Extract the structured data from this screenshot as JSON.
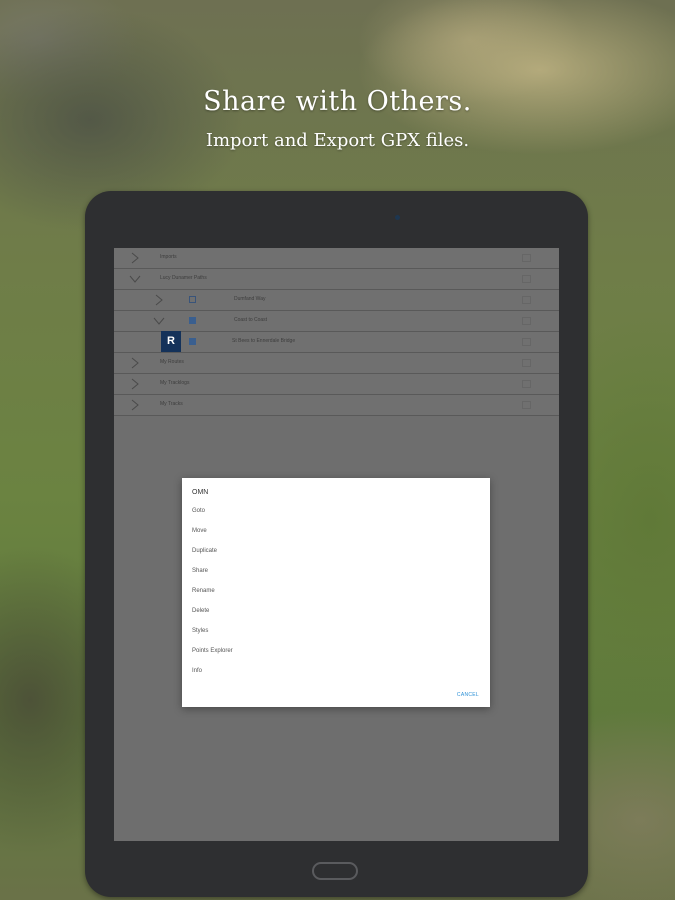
{
  "promo": {
    "headline": "Share with Others.",
    "subline": "Import and Export GPX files."
  },
  "tree": {
    "rows": [
      {
        "label": "Imports",
        "expanded": false,
        "indent": 0
      },
      {
        "label": "Lucy Dunamer Paths",
        "expanded": true,
        "indent": 0
      },
      {
        "label": "Dumfand Way",
        "expanded": false,
        "indent": 1,
        "checked": false
      },
      {
        "label": "Coast to Coast",
        "expanded": true,
        "indent": 1,
        "checked": true
      },
      {
        "label": "St Bees to Ennerdale Bridge",
        "indent": 2,
        "checked": true,
        "badge": "R"
      },
      {
        "label": "My Routes",
        "expanded": false,
        "indent": 0
      },
      {
        "label": "My Tracklogs",
        "expanded": false,
        "indent": 0
      },
      {
        "label": "My Tracks",
        "expanded": false,
        "indent": 0
      }
    ]
  },
  "dialog": {
    "title": "OMN",
    "items": [
      "Goto",
      "Move",
      "Duplicate",
      "Share",
      "Rename",
      "Delete",
      "Styles",
      "Points Explorer",
      "Info"
    ],
    "cancel_label": "CANCEL"
  },
  "colors": {
    "accent": "#2a8fd6",
    "badge": "#14325a",
    "checkbox": "#3a5f8f"
  }
}
